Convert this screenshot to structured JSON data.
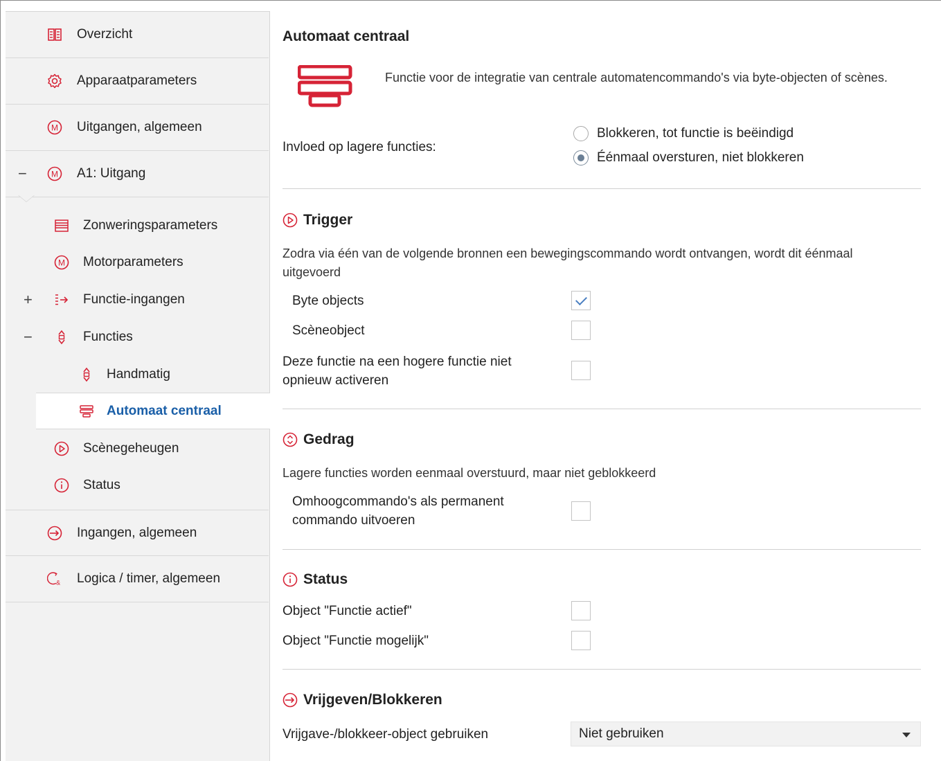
{
  "colors": {
    "accent_red": "#d62336",
    "selected_blue": "#1a5fa8",
    "check_blue": "#4a7fc1"
  },
  "sidebar": {
    "items": [
      {
        "label": "Overzicht",
        "icon": "book-icon",
        "expander": ""
      },
      {
        "label": "Apparaatparameters",
        "icon": "gear-icon",
        "expander": ""
      },
      {
        "label": "Uitgangen, algemeen",
        "icon": "motor-m-icon",
        "expander": ""
      },
      {
        "label": "A1: Uitgang",
        "icon": "motor-m-icon",
        "expander": "−"
      }
    ],
    "subitems": [
      {
        "label": "Zonweringsparameters",
        "icon": "blind-icon",
        "expander": ""
      },
      {
        "label": "Motorparameters",
        "icon": "motor-m-icon",
        "expander": ""
      },
      {
        "label": "Functie-ingangen",
        "icon": "input-arrow-icon",
        "expander": "+"
      },
      {
        "label": "Functies",
        "icon": "up-down-icon",
        "expander": "−"
      },
      {
        "label": "Handmatig",
        "icon": "up-down-icon",
        "expander": ""
      },
      {
        "label": "Automaat centraal",
        "icon": "central-automat-icon",
        "expander": ""
      },
      {
        "label": "Scènegeheugen",
        "icon": "play-circle-icon",
        "expander": ""
      },
      {
        "label": "Status",
        "icon": "info-circle-icon",
        "expander": ""
      }
    ],
    "bottom_items": [
      {
        "label": "Ingangen, algemeen",
        "icon": "input-circle-icon"
      },
      {
        "label": "Logica / timer, algemeen",
        "icon": "logic-timer-icon"
      }
    ]
  },
  "main": {
    "title": "Automaat centraal",
    "description": "Functie voor de integratie van centrale automatencommando's via byte-objecten of scènes.",
    "influence": {
      "label": "Invloed op lagere functies:",
      "options": [
        "Blokkeren, tot functie is beëindigd",
        "Éénmaal oversturen, niet blokkeren"
      ],
      "selected_index": 1
    },
    "trigger": {
      "heading": "Trigger",
      "text": "Zodra via één van de volgende bronnen een bewegingscommando wordt ontvangen, wordt dit éénmaal uitgevoerd",
      "byte_objects": {
        "label": "Byte objects",
        "checked": true
      },
      "sceneobject": {
        "label": "Scèneobject",
        "checked": false
      },
      "no_reactivate": {
        "label": "Deze functie na een hogere functie niet opnieuw activeren",
        "checked": false
      }
    },
    "gedrag": {
      "heading": "Gedrag",
      "text": "Lagere functies worden eenmaal overstuurd, maar niet geblokkeerd",
      "permanent_up": {
        "label": "Omhoogcommando's als permanent commando uitvoeren",
        "checked": false
      }
    },
    "status": {
      "heading": "Status",
      "obj_active": {
        "label": "Object \"Functie actief\"",
        "checked": false
      },
      "obj_possible": {
        "label": "Object \"Functie mogelijk\"",
        "checked": false
      }
    },
    "release": {
      "heading": "Vrijgeven/Blokkeren",
      "label": "Vrijgave-/blokkeer-object gebruiken",
      "selected": "Niet gebruiken"
    }
  }
}
